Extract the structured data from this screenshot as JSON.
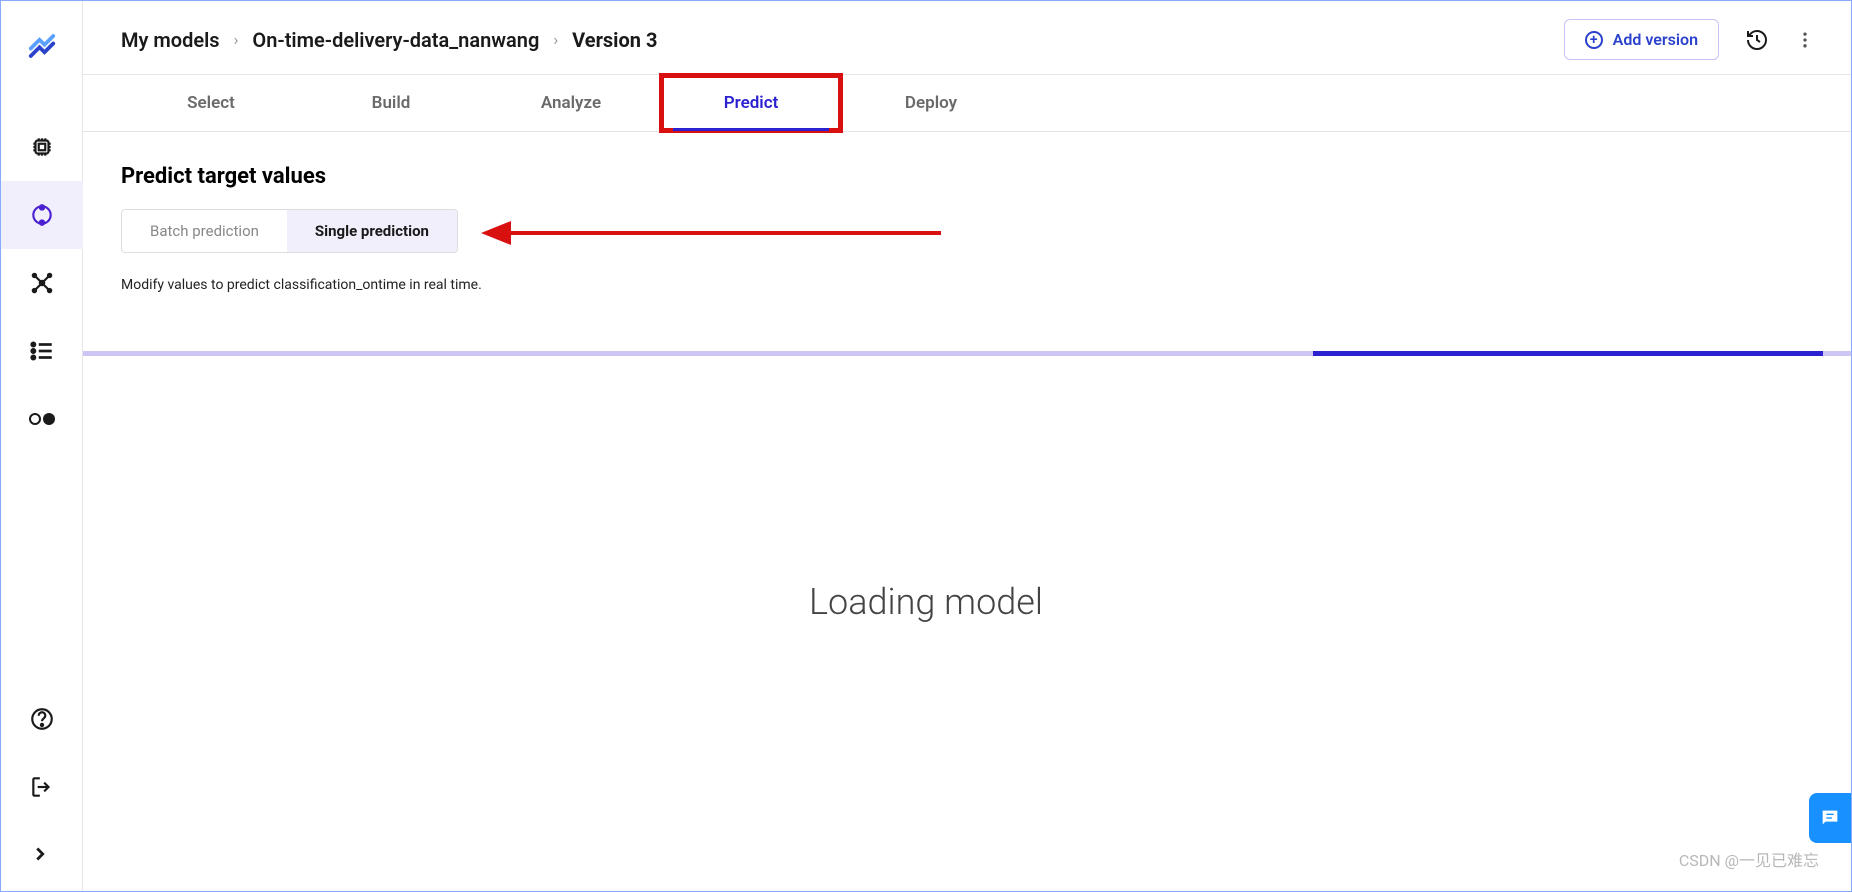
{
  "breadcrumb": {
    "root": "My models",
    "model": "On-time-delivery-data_nanwang",
    "version": "Version 3"
  },
  "header": {
    "add_version_label": "Add version"
  },
  "tabs": {
    "items": [
      {
        "label": "Select",
        "active": false
      },
      {
        "label": "Build",
        "active": false
      },
      {
        "label": "Analyze",
        "active": false
      },
      {
        "label": "Predict",
        "active": true
      },
      {
        "label": "Deploy",
        "active": false
      }
    ]
  },
  "predict": {
    "title": "Predict target values",
    "modes": {
      "batch": "Batch prediction",
      "single": "Single prediction"
    },
    "hint": "Modify values to predict classification_ontime in real time."
  },
  "status": {
    "loading": "Loading model"
  },
  "watermark": "CSDN @一见已难忘"
}
